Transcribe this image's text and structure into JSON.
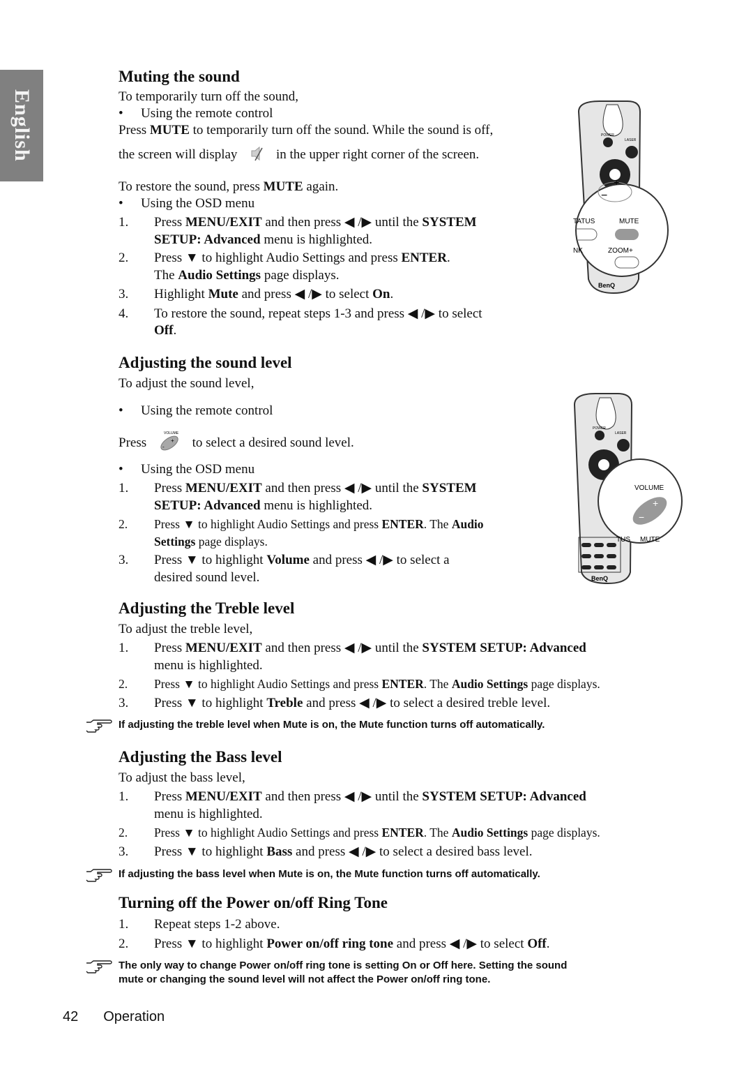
{
  "side_tab": "English",
  "sections": {
    "muting": {
      "title": "Muting the sound",
      "intro": "To temporarily turn off the sound,",
      "bullet_remote": "Using the remote control",
      "remote_line1_pre": "Press ",
      "remote_line1_bold": "MUTE",
      "remote_line1_post": " to temporarily turn off the sound. While the sound is off,",
      "remote_line2_pre": "the screen will display",
      "remote_line2_post": "in the upper right corner of the screen.",
      "restore_pre": "To restore the sound, press ",
      "restore_bold": "MUTE",
      "restore_post": " again.",
      "bullet_osd": "Using the OSD menu",
      "steps": [
        {
          "n": "1.",
          "a": "Press ",
          "b": "MENU/EXIT",
          "c": " and then press ◀ /▶  until the ",
          "d": "SYSTEM",
          "e": "SETUP: Advanced",
          "f": " menu is highlighted."
        },
        {
          "n": "2.",
          "a": "Press ▼  to highlight Audio Settings and press ",
          "b": "ENTER",
          "c": ".",
          "d": "The ",
          "e": "Audio Settings",
          "f": " page displays."
        },
        {
          "n": "3.",
          "a": "Highlight ",
          "b": "Mute",
          "c": " and press ◀ /▶  to select ",
          "d": "On",
          "e": "."
        },
        {
          "n": "4.",
          "a": "To restore the sound, repeat steps 1-3 and press ◀ /▶  to select",
          "b": "Off",
          "c": "."
        }
      ],
      "remote_labels": {
        "status": "TATUS",
        "mute": "MUTE",
        "blank": "NK",
        "zoom": "ZOOM+",
        "power": "POWER",
        "laser": "LASER",
        "brand": "BenQ"
      }
    },
    "sound_level": {
      "title": "Adjusting the sound level",
      "intro": "To adjust the sound level,",
      "bullet_remote": "Using the remote control",
      "press": "Press",
      "press_post": "to select a desired sound level.",
      "volume_icon_label": "VOLUME",
      "bullet_osd": "Using the OSD menu",
      "steps": [
        {
          "n": "1.",
          "a": "Press ",
          "b": "MENU/EXIT",
          "c": " and then press ◀ /▶  until the ",
          "d": "SYSTEM",
          "e": "SETUP: Advanced",
          "f": " menu is highlighted."
        },
        {
          "n": "2.",
          "a": "Press ▼  to highlight Audio Settings and press ",
          "b": "ENTER",
          "c": ". The ",
          "d": "Audio",
          "e": "Settings",
          "f": " page displays."
        },
        {
          "n": "3.",
          "a": "Press ▼  to highlight ",
          "b": "Volume",
          "c": " and press ◀ /▶  to select a",
          "d": "desired sound level."
        }
      ],
      "remote_labels": {
        "volume": "VOLUME",
        "status": "TUS",
        "mute": "MUTE",
        "power": "POWER",
        "laser": "LASER",
        "brand": "BenQ"
      }
    },
    "treble": {
      "title": "Adjusting the Treble level",
      "intro": "To adjust the treble level,",
      "steps": [
        {
          "n": "1.",
          "a": "Press ",
          "b": "MENU/EXIT",
          "c": " and then press ◀ /▶  until the ",
          "d": "SYSTEM SETUP: Advanced",
          "e": "menu is highlighted."
        },
        {
          "n": "2.",
          "a": "Press ▼  to highlight Audio Settings and press ",
          "b": "ENTER",
          "c": ". The ",
          "d": "Audio Settings",
          "e": " page displays."
        },
        {
          "n": "3.",
          "a": "Press ▼  to highlight ",
          "b": "Treble",
          "c": " and press ◀ /▶  to select a desired treble level."
        }
      ],
      "note": "If adjusting the treble level when Mute is on, the Mute function turns off automatically."
    },
    "bass": {
      "title": "Adjusting the Bass level",
      "intro": "To adjust the bass level,",
      "steps": [
        {
          "n": "1.",
          "a": "Press ",
          "b": "MENU/EXIT",
          "c": " and then press ◀ /▶  until the ",
          "d": "SYSTEM SETUP: Advanced",
          "e": "menu is highlighted."
        },
        {
          "n": "2.",
          "a": "Press ▼  to highlight Audio Settings and press ",
          "b": "ENTER",
          "c": ". The ",
          "d": "Audio Settings",
          "e": " page displays."
        },
        {
          "n": "3.",
          "a": "Press ▼  to highlight ",
          "b": "Bass",
          "c": " and press ◀ /▶  to select a desired bass level."
        }
      ],
      "note": "If adjusting the bass level when Mute is on, the Mute function turns off automatically."
    },
    "ring_tone": {
      "title": "Turning off the Power on/off Ring Tone",
      "steps": [
        {
          "n": "1.",
          "a": "Repeat steps 1-2 above."
        },
        {
          "n": "2.",
          "a": "Press ▼  to highlight ",
          "b": "Power on/off ring tone",
          "c": " and press ◀ /▶  to select ",
          "d": "Off",
          "e": "."
        }
      ],
      "note_line1": "The only way to change Power on/off ring tone is setting On or Off here. Setting the sound",
      "note_line2": "mute or changing the sound level will not affect the Power on/off ring tone."
    }
  },
  "footer": {
    "page_number": "42",
    "section": "Operation"
  }
}
